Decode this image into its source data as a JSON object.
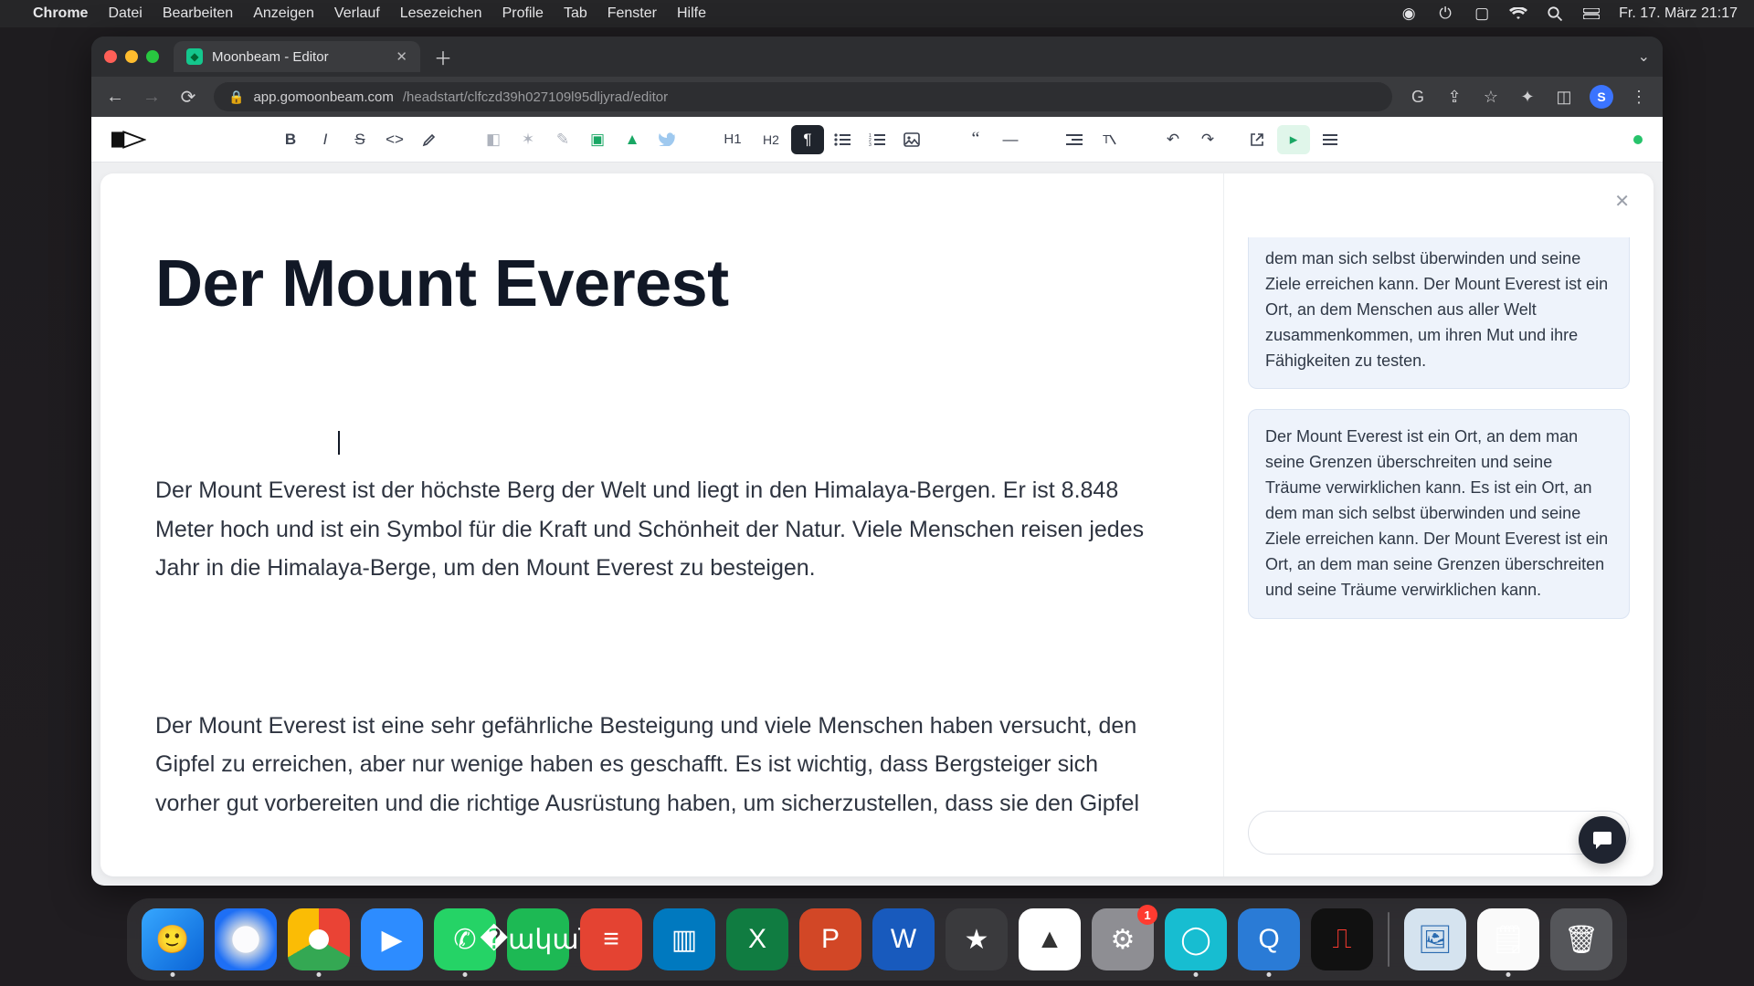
{
  "menubar": {
    "app": "Chrome",
    "items": [
      "Datei",
      "Bearbeiten",
      "Anzeigen",
      "Verlauf",
      "Lesezeichen",
      "Profile",
      "Tab",
      "Fenster",
      "Hilfe"
    ],
    "clock": "Fr. 17. März  21:17"
  },
  "browser": {
    "tab_title": "Moonbeam - Editor",
    "url_host": "app.gomoonbeam.com",
    "url_path": "/headstart/clfczd39h027109l95dljyrad/editor",
    "avatar_initial": "S"
  },
  "toolbar": {
    "bold": "B",
    "italic": "I",
    "strike": "S",
    "h1": "H1",
    "h2": "H2"
  },
  "document": {
    "title": "Der Mount Everest",
    "p1": "Der Mount Everest ist der höchste Berg der Welt und liegt in den Himalaya-Bergen. Er ist 8.848 Meter hoch und ist ein Symbol für die Kraft und Schönheit der Natur. Viele Menschen reisen jedes Jahr in die Himalaya-Berge, um den Mount Everest zu besteigen.",
    "p2": "Der Mount Everest ist eine sehr gefährliche Besteigung und viele Menschen haben versucht, den Gipfel zu erreichen, aber nur wenige haben es geschafft. Es ist wichtig, dass Bergsteiger sich vorher gut vorbereiten und die richtige Ausrüstung haben, um sicherzustellen, dass sie den Gipfel"
  },
  "side": {
    "msg1": "dem man sich selbst überwinden und seine Ziele erreichen kann. Der Mount Everest ist ein Ort, an dem Menschen aus aller Welt zusammenkommen, um ihren Mut und ihre Fähigkeiten zu testen.",
    "msg2": "Der Mount Everest ist ein Ort, an dem man seine Grenzen überschreiten und seine Träume verwirklichen kann. Es ist ein Ort, an dem man sich selbst überwinden und seine Ziele erreichen kann. Der Mount Everest ist ein Ort, an dem man seine Grenzen überschreiten und seine Träume verwirklichen kann.",
    "input_placeholder": ""
  },
  "dock": {
    "settings_badge": "1"
  }
}
